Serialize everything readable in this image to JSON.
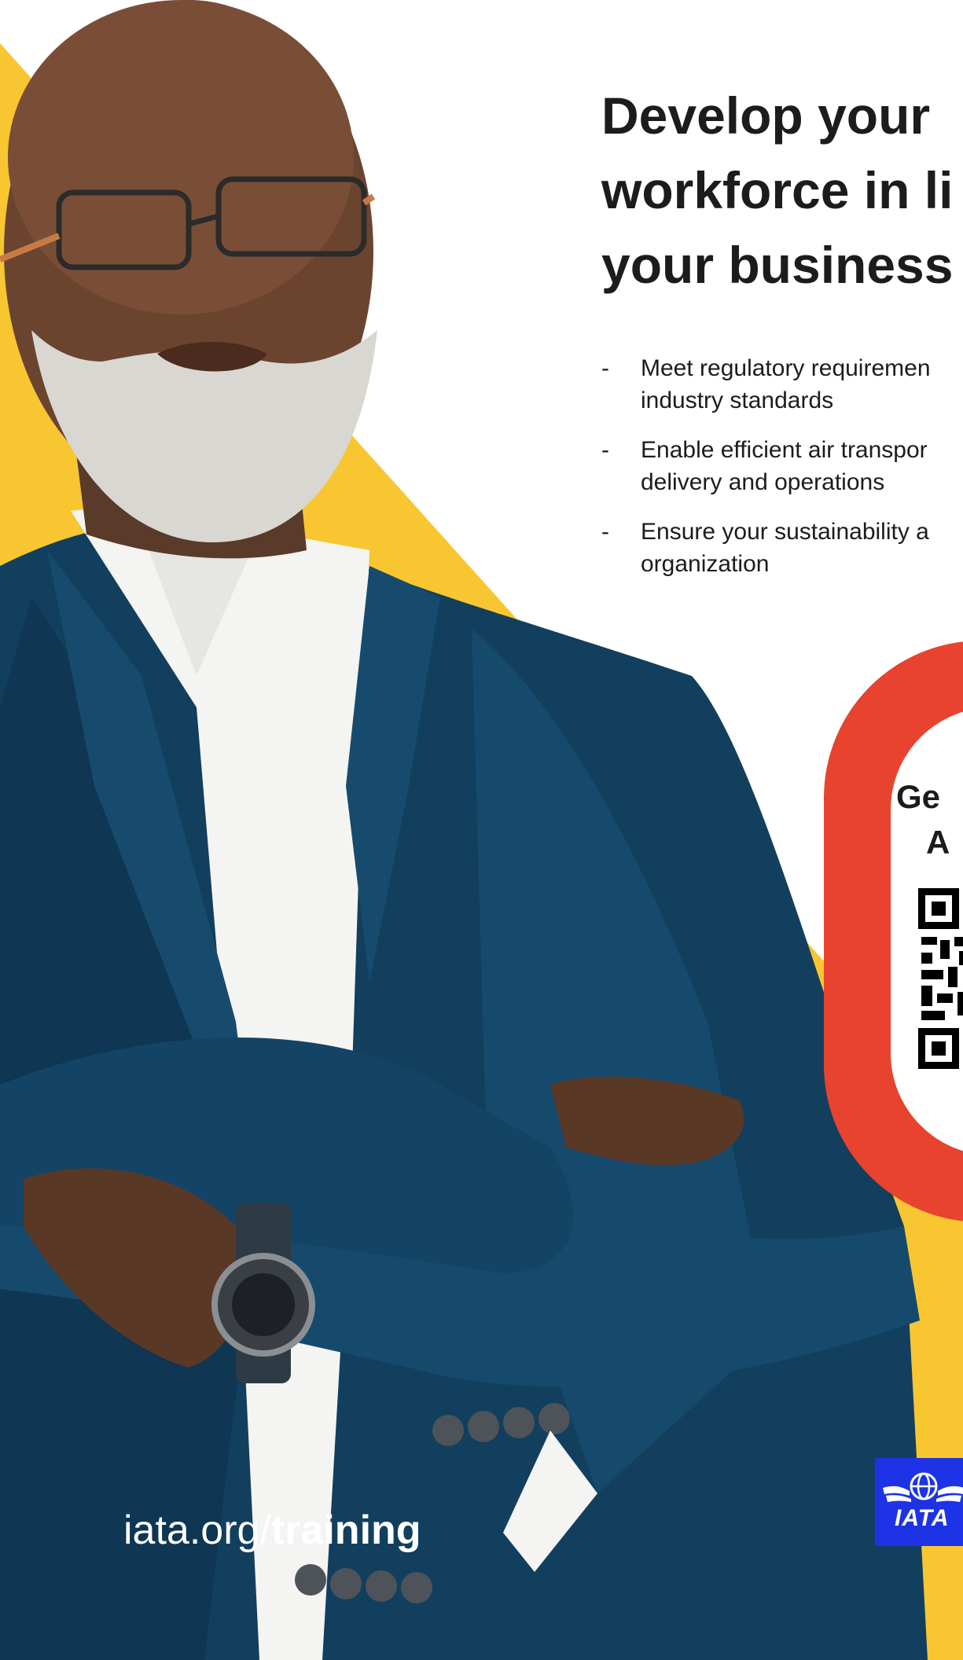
{
  "headline": {
    "line1": "Develop your",
    "line2": "workforce in li",
    "line3": "your business"
  },
  "bullets": [
    {
      "dash": "-",
      "line1": "Meet regulatory requiremen",
      "line2": "industry standards"
    },
    {
      "dash": "-",
      "line1": "Enable efficient air transpor",
      "line2": "delivery and operations"
    },
    {
      "dash": "-",
      "line1": "Ensure your sustainability a",
      "line2": "organization"
    }
  ],
  "cta": {
    "line1": "Ge",
    "line2": "A"
  },
  "footer": {
    "url_prefix": "iata.org/",
    "url_emphasis": "training"
  },
  "logo": {
    "wordmark": "IATA"
  },
  "colors": {
    "background": "#ffffff",
    "accent_yellow": "#f8c630",
    "cta_red": "#e8432f",
    "jacket_blue": "#123f5e",
    "logo_blue": "#1e33e6",
    "text_dark": "#1c1c1c"
  },
  "icons": {
    "qr": "qr-code-icon",
    "logo": "iata-globe-wings-icon"
  }
}
